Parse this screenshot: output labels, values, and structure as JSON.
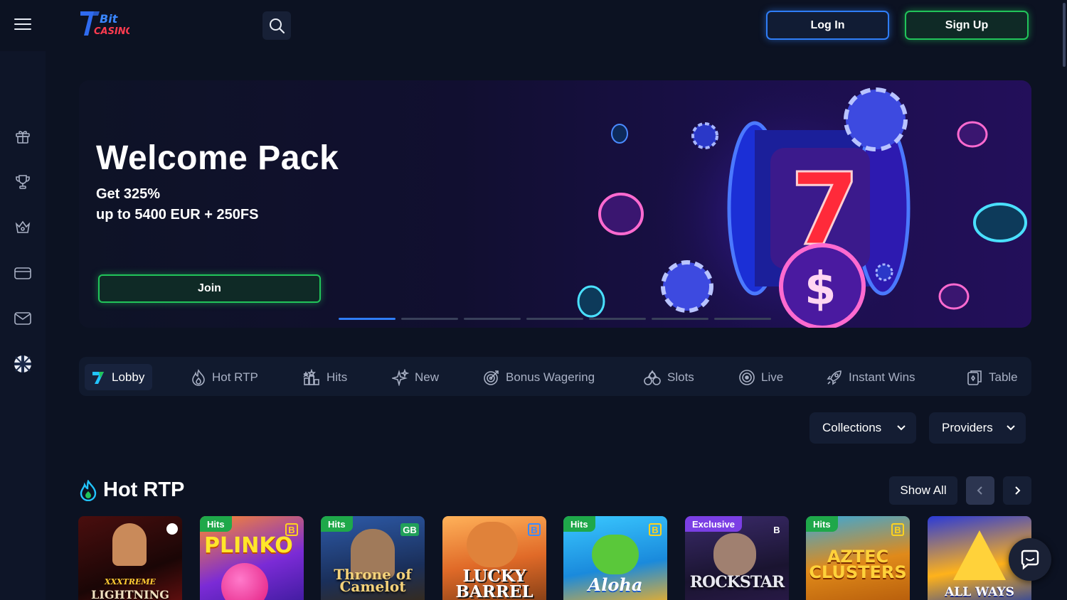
{
  "header": {
    "logo_text": "7Bit CASINO",
    "login_label": "Log In",
    "signup_label": "Sign Up"
  },
  "sidebar": {
    "items": [
      {
        "icon": "gift-icon"
      },
      {
        "icon": "trophy-icon"
      },
      {
        "icon": "crown-icon"
      },
      {
        "icon": "card-icon"
      },
      {
        "icon": "mail-icon"
      },
      {
        "icon": "language-icon"
      }
    ]
  },
  "banner": {
    "title": "Welcome Pack",
    "line1": "Get 325%",
    "line2": "up to 5400 EUR + 250FS",
    "join_label": "Join",
    "slides_total": 7,
    "active_slide": 1
  },
  "categories": [
    {
      "label": "Lobby",
      "icon": "lobby-icon",
      "active": true
    },
    {
      "label": "Hot RTP",
      "icon": "flame-icon"
    },
    {
      "label": "Hits",
      "icon": "hits-icon"
    },
    {
      "label": "New",
      "icon": "sparkle-icon"
    },
    {
      "label": "Bonus Wagering",
      "icon": "target-icon"
    },
    {
      "label": "Slots",
      "icon": "cherries-icon"
    },
    {
      "label": "Live",
      "icon": "live-icon"
    },
    {
      "label": "Instant Wins",
      "icon": "rocket-icon"
    },
    {
      "label": "Table",
      "icon": "table-icon"
    }
  ],
  "filters": {
    "collections_label": "Collections",
    "providers_label": "Providers"
  },
  "section": {
    "title": "Hot RTP",
    "show_all_label": "Show All"
  },
  "games": [
    {
      "title": "LIGHTNING",
      "subtitle": "XXXTREME",
      "tag": "",
      "provider": ""
    },
    {
      "title": "PLINKO",
      "tag": "Hits",
      "provider": "B"
    },
    {
      "title": "Throne of Camelot",
      "tag": "Hits",
      "provider": "GB"
    },
    {
      "title": "LUCKY BARREL",
      "tag": "",
      "provider": "B"
    },
    {
      "title": "Aloha",
      "tag": "Hits",
      "provider": "B"
    },
    {
      "title": "ROCKSTAR",
      "tag": "Exclusive",
      "provider": "B"
    },
    {
      "title": "AZTEC CLUSTERS",
      "tag": "Hits",
      "provider": "B"
    },
    {
      "title": "ALL WAYS",
      "tag": "",
      "provider": ""
    }
  ],
  "colors": {
    "accent_blue": "#2f7df6",
    "accent_green": "#21c45a",
    "tag_green": "#1fa84a",
    "tag_purple": "#7b3fe4",
    "background": "#0c1222"
  }
}
